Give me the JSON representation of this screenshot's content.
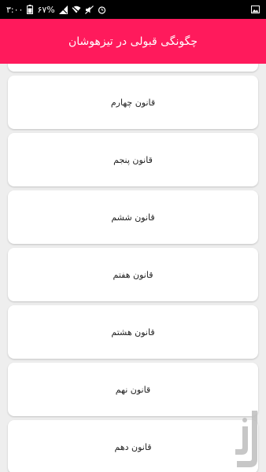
{
  "status_bar": {
    "time": "۳:۰۰",
    "battery": "۶۷%"
  },
  "app_bar": {
    "title": "چگونگی قبولی در تیزهوشان"
  },
  "list": {
    "items": [
      {
        "label": ""
      },
      {
        "label": "قانون چهارم"
      },
      {
        "label": "قانون پنجم"
      },
      {
        "label": "قانون ششم"
      },
      {
        "label": "قانون هفتم"
      },
      {
        "label": "قانون هشتم"
      },
      {
        "label": "قانون نهم"
      },
      {
        "label": "قانون دهم"
      }
    ]
  },
  "colors": {
    "accent": "#ff1a5c",
    "status_bar": "#000000",
    "background": "#eeeeee",
    "card": "#ffffff"
  }
}
